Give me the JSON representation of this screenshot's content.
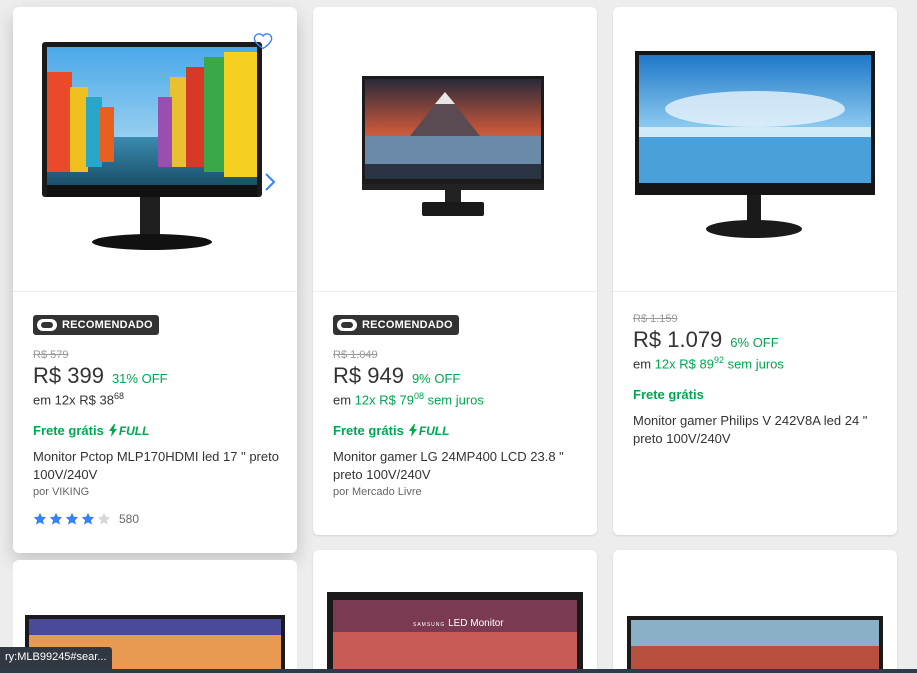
{
  "products": [
    {
      "badge": "RECOMENDADO",
      "old_price": "R$ 579",
      "price": "R$ 399",
      "discount": "31% OFF",
      "installment_prefix": "em 12x R$ 38",
      "installment_cents": "68",
      "installment_suffix": "",
      "shipping": "Frete grátis",
      "full_label": "FULL",
      "title": "Monitor Pctop MLP170HDMI led 17 \" preto 100V/240V",
      "seller": "por VIKING",
      "rating": 4,
      "reviews": "580",
      "image": "monitor-colorful-houses"
    },
    {
      "badge": "RECOMENDADO",
      "old_price": "R$ 1.049",
      "price": "R$ 949",
      "discount": "9% OFF",
      "installment_prefix": "em ",
      "installment_green": "12x R$ 79",
      "installment_cents": "08",
      "installment_suffix": " sem juros",
      "shipping": "Frete grátis",
      "full_label": "FULL",
      "title": "Monitor gamer LG 24MP400 LCD 23.8 \" preto 100V/240V",
      "seller": "por Mercado Livre",
      "image": "monitor-mountain-lake"
    },
    {
      "old_price": "R$ 1.159",
      "price": "R$ 1.079",
      "discount": "6% OFF",
      "installment_prefix": "em ",
      "installment_green": "12x R$ 89",
      "installment_cents": "92",
      "installment_suffix": " sem juros",
      "shipping": "Frete grátis",
      "title": "Monitor gamer Philips V 242V8A led 24 \" preto 100V/240V",
      "image": "monitor-blue-sky"
    }
  ],
  "bottom_row": {
    "samsung_label": "SAMSUNG",
    "led_monitor_label": "LED Monitor"
  },
  "status_url": "ry:MLB99245#sear...",
  "colors": {
    "green": "#00a650",
    "blue_star": "#3483fa",
    "badge_bg": "#333333"
  }
}
